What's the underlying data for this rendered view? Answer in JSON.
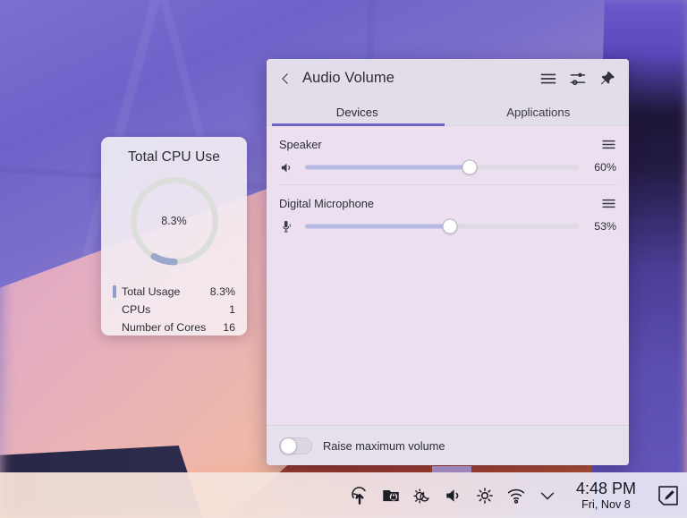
{
  "cpu_widget": {
    "title": "Total CPU Use",
    "center_value": "8.3%",
    "rows": [
      {
        "label": "Total Usage",
        "value": "8.3%"
      },
      {
        "label": "CPUs",
        "value": "1"
      },
      {
        "label": "Number of Cores",
        "value": "16"
      }
    ],
    "usage_percent": 8.3,
    "arc_color": "#9aa8cc",
    "track_color": "#dcdedb"
  },
  "audio_popup": {
    "title": "Audio Volume",
    "back_icon": "chevron-left-icon",
    "header_icons": [
      "hamburger-menu-icon",
      "mixer-sliders-icon",
      "pin-icon"
    ],
    "tabs": [
      {
        "label": "Devices",
        "active": true
      },
      {
        "label": "Applications",
        "active": false
      }
    ],
    "devices": [
      {
        "name": "Speaker",
        "icon": "speaker-icon",
        "volume": 60,
        "volume_label": "60%",
        "menu_icon": "hamburger-menu-icon"
      },
      {
        "name": "Digital Microphone",
        "icon": "microphone-icon",
        "volume": 53,
        "volume_label": "53%",
        "menu_icon": "hamburger-menu-icon"
      }
    ],
    "footer": {
      "toggle_label": "Raise maximum volume",
      "toggle_on": false
    },
    "accent_color": "#6f63c4"
  },
  "taskbar": {
    "tray_icons": [
      "software-update-icon",
      "vault-lock-icon",
      "night-color-icon",
      "volume-icon",
      "brightness-icon",
      "wifi-icon",
      "chevron-down-icon"
    ],
    "clock": {
      "time": "4:48 PM",
      "date": "Fri, Nov 8"
    },
    "edit_button_icon": "notes-edit-icon"
  }
}
